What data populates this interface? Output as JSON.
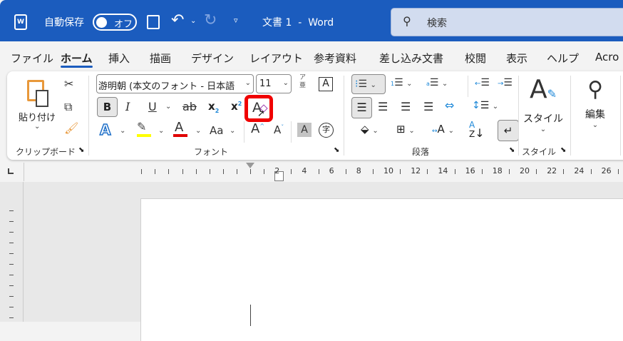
{
  "titlebar": {
    "autosave_label": "自動保存",
    "autosave_state": "オフ",
    "doc_title": "文書 1  -  Word",
    "search_placeholder": "検索"
  },
  "tabs": [
    "ファイル",
    "ホーム",
    "挿入",
    "描画",
    "デザイン",
    "レイアウト",
    "参考資料",
    "差し込み文書",
    "校閲",
    "表示",
    "ヘルプ",
    "Acro"
  ],
  "active_tab": "ホーム",
  "ribbon": {
    "clipboard": {
      "paste_label": "貼り付け",
      "group_label": "クリップボード"
    },
    "font": {
      "font_name": "游明朝 (本文のフォント - 日本語",
      "font_size": "11",
      "group_label": "フォント",
      "ruby_top": "ア",
      "ruby_bottom": "亜",
      "bold": "B",
      "italic": "I",
      "underline": "U",
      "strike": "ab",
      "sub": "x",
      "sup": "x",
      "case": "Aa",
      "grow": "A",
      "shrink": "A",
      "shade": "A",
      "enclose": "字",
      "highlight_color": "#ffff00",
      "font_color": "#e00000",
      "highlight_box_color": "#e00000"
    },
    "paragraph": {
      "group_label": "段落"
    },
    "styles": {
      "button_label": "スタイル",
      "group_label": "スタイル"
    },
    "editing": {
      "button_label": "編集"
    }
  },
  "ruler": {
    "labels": [
      "2",
      "4",
      "6",
      "8",
      "10",
      "12",
      "14",
      "16",
      "18",
      "20",
      "22",
      "24",
      "26"
    ]
  },
  "colors": {
    "titlebar": "#1b5cbe",
    "accent": "#1b5cbe"
  }
}
